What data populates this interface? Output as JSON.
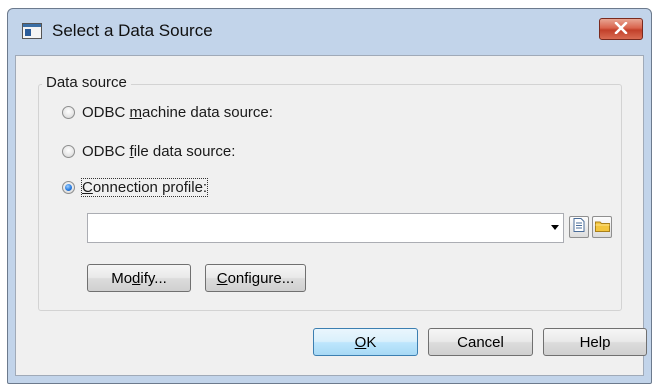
{
  "window": {
    "title": "Select a Data Source",
    "close_glyph": "✕"
  },
  "group": {
    "legend": "Data source"
  },
  "radios": [
    {
      "pre": "ODBC ",
      "mnemonic": "m",
      "post": "achine data source:",
      "checked": false
    },
    {
      "pre": "ODBC ",
      "mnemonic": "f",
      "post": "ile data source:",
      "checked": false
    },
    {
      "pre": "",
      "mnemonic": "C",
      "post": "onnection profile:",
      "checked": true
    }
  ],
  "profile_combo": {
    "value": ""
  },
  "buttons": {
    "modify": {
      "pre": "Mo",
      "mnemonic": "d",
      "post": "ify..."
    },
    "configure": {
      "pre": "",
      "mnemonic": "C",
      "post": "onfigure..."
    },
    "ok": {
      "pre": "",
      "mnemonic": "O",
      "post": "K"
    },
    "cancel": "Cancel",
    "help": "Help"
  },
  "icons": {
    "title": "window-icon",
    "properties": "properties-icon",
    "browse": "folder-icon"
  }
}
